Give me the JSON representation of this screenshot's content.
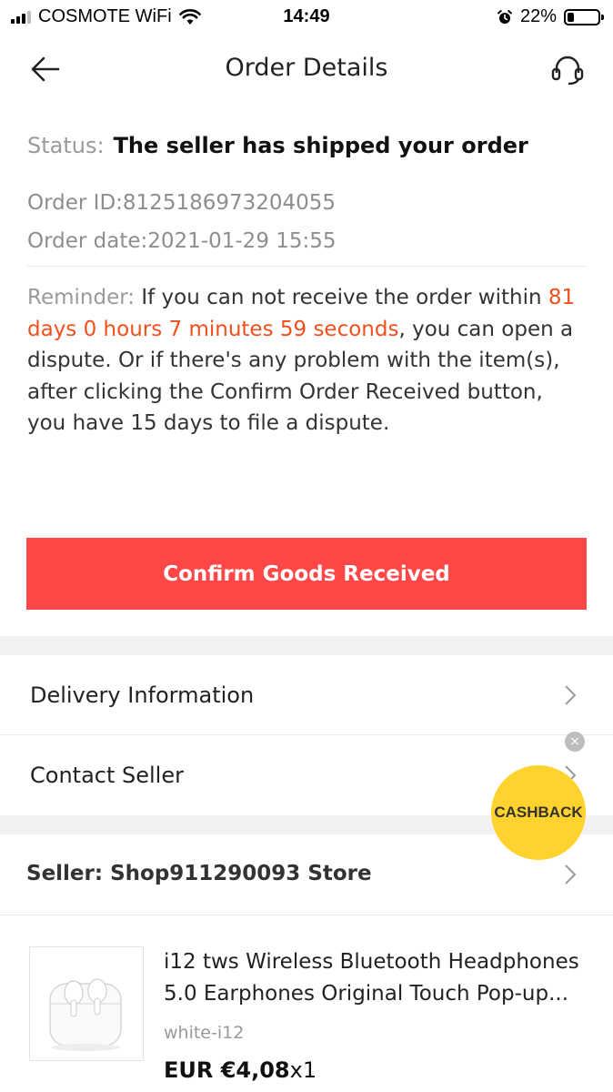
{
  "status_bar": {
    "carrier": "COSMOTE WiFi",
    "time": "14:49",
    "battery": "22%",
    "battery_level": 0.22
  },
  "header": {
    "title": "Order Details"
  },
  "order": {
    "status_label": "Status:",
    "status_value": "The seller has shipped your order",
    "order_id": "Order ID:8125186973204055",
    "order_date": "Order date:2021-01-29 15:55",
    "reminder_label": "Reminder:",
    "reminder_text_1": " If you can not receive the order within ",
    "reminder_countdown": "81 days 0 hours 7 minutes 59 seconds",
    "reminder_text_2": ", you can open a dispute. Or if there's any problem with the item(s), after clicking the Confirm Order Received button, you have 15 days to file a dispute."
  },
  "actions": {
    "confirm_label": "Confirm Goods Received"
  },
  "rows": {
    "delivery": "Delivery Information",
    "contact": "Contact Seller",
    "seller": "Seller: Shop911290093 Store"
  },
  "cashback": {
    "label": "CASHBACK",
    "close": "×"
  },
  "product": {
    "title": "i12 tws Wireless Bluetooth Headphones 5.0 Earphones Original  Touch Pop-up...",
    "variant": "white-i12",
    "price": "EUR €4,08",
    "quantity": "x1"
  },
  "colors": {
    "accent_red": "#ff4747",
    "countdown_orange": "#f1501d",
    "cashback_yellow": "#ffd22e"
  },
  "icons": {
    "back": "arrow-left-icon",
    "support": "headset-icon",
    "alarm": "alarm-icon",
    "chevron": "chevron-right-icon"
  }
}
